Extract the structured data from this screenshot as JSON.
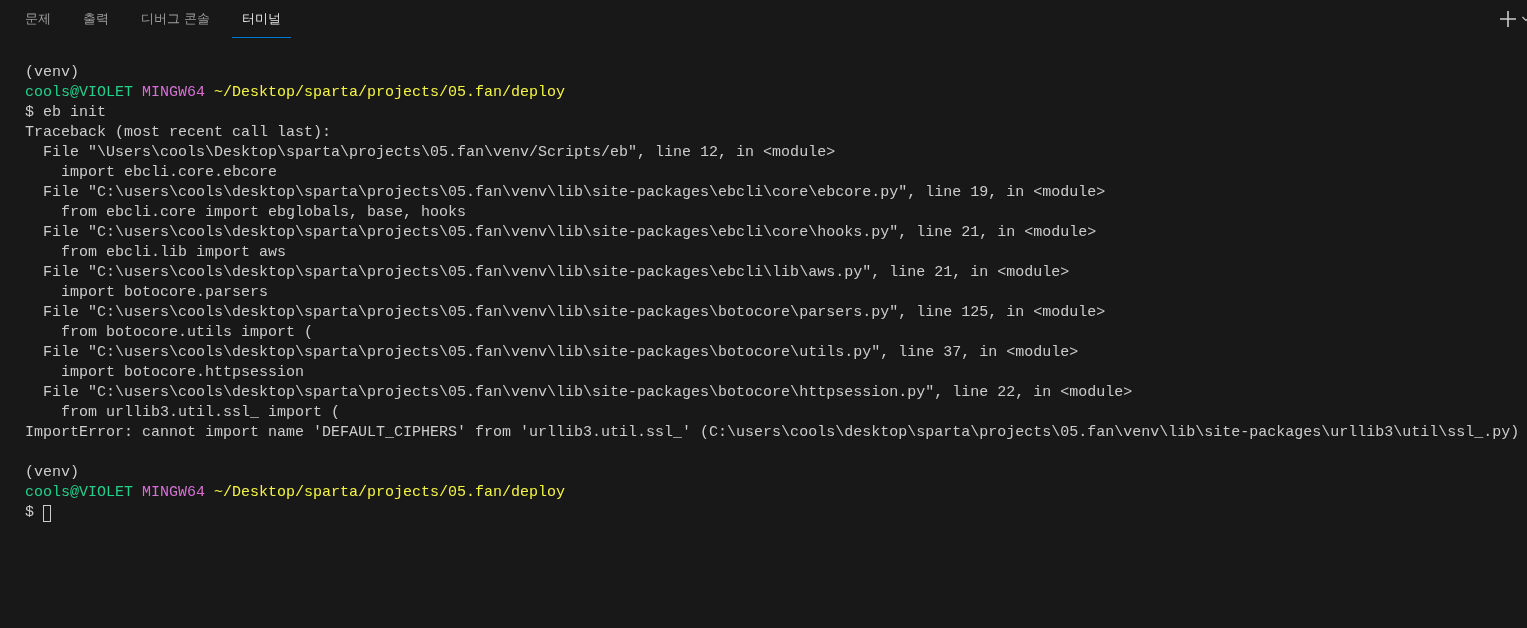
{
  "tabs": [
    {
      "label": "문제",
      "selected": false
    },
    {
      "label": "출력",
      "selected": false
    },
    {
      "label": "디버그 콘솔",
      "selected": false
    },
    {
      "label": "터미널",
      "selected": true
    }
  ],
  "terminal": {
    "lines": [
      {
        "kind": "plain",
        "text": "(venv)"
      },
      {
        "kind": "prompt",
        "user_host": "cools@VIOLET",
        "shell": "MINGW64",
        "path": "~/Desktop/sparta/projects/05.fan/deploy"
      },
      {
        "kind": "input",
        "symbol": "$",
        "command": "eb init",
        "cursor": false
      },
      {
        "kind": "plain",
        "text": "Traceback (most recent call last):"
      },
      {
        "kind": "plain",
        "text": "  File \"\\Users\\cools\\Desktop\\sparta\\projects\\05.fan\\venv/Scripts/eb\", line 12, in <module>"
      },
      {
        "kind": "plain",
        "text": "    import ebcli.core.ebcore"
      },
      {
        "kind": "plain",
        "text": "  File \"C:\\users\\cools\\desktop\\sparta\\projects\\05.fan\\venv\\lib\\site-packages\\ebcli\\core\\ebcore.py\", line 19, in <module>"
      },
      {
        "kind": "plain",
        "text": "    from ebcli.core import ebglobals, base, hooks"
      },
      {
        "kind": "plain",
        "text": "  File \"C:\\users\\cools\\desktop\\sparta\\projects\\05.fan\\venv\\lib\\site-packages\\ebcli\\core\\hooks.py\", line 21, in <module>"
      },
      {
        "kind": "plain",
        "text": "    from ebcli.lib import aws"
      },
      {
        "kind": "plain",
        "text": "  File \"C:\\users\\cools\\desktop\\sparta\\projects\\05.fan\\venv\\lib\\site-packages\\ebcli\\lib\\aws.py\", line 21, in <module>"
      },
      {
        "kind": "plain",
        "text": "    import botocore.parsers"
      },
      {
        "kind": "plain",
        "text": "  File \"C:\\users\\cools\\desktop\\sparta\\projects\\05.fan\\venv\\lib\\site-packages\\botocore\\parsers.py\", line 125, in <module>"
      },
      {
        "kind": "plain",
        "text": "    from botocore.utils import ("
      },
      {
        "kind": "plain",
        "text": "  File \"C:\\users\\cools\\desktop\\sparta\\projects\\05.fan\\venv\\lib\\site-packages\\botocore\\utils.py\", line 37, in <module>"
      },
      {
        "kind": "plain",
        "text": "    import botocore.httpsession"
      },
      {
        "kind": "plain",
        "text": "  File \"C:\\users\\cools\\desktop\\sparta\\projects\\05.fan\\venv\\lib\\site-packages\\botocore\\httpsession.py\", line 22, in <module>"
      },
      {
        "kind": "plain",
        "text": "    from urllib3.util.ssl_ import ("
      },
      {
        "kind": "plain",
        "text": "ImportError: cannot import name 'DEFAULT_CIPHERS' from 'urllib3.util.ssl_' (C:\\users\\cools\\desktop\\sparta\\projects\\05.fan\\venv\\lib\\site-packages\\urllib3\\util\\ssl_.py)"
      },
      {
        "kind": "blank"
      },
      {
        "kind": "plain",
        "text": "(venv)"
      },
      {
        "kind": "prompt",
        "user_host": "cools@VIOLET",
        "shell": "MINGW64",
        "path": "~/Desktop/sparta/projects/05.fan/deploy"
      },
      {
        "kind": "input",
        "symbol": "$",
        "cursor": true
      }
    ]
  }
}
